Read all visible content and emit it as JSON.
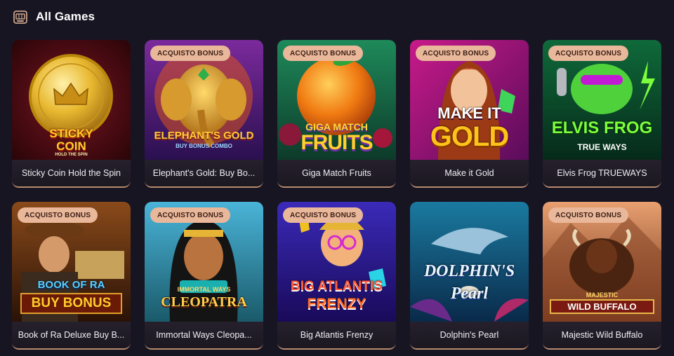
{
  "header": {
    "title": "All Games",
    "icon": "slot-machine-icon"
  },
  "badge_text": "ACQUISTO BONUS",
  "games": [
    {
      "title": "Sticky Coin Hold the Spin",
      "logo_line1": "STICKY",
      "logo_line2": "COIN",
      "logo_line3": "HOLD THE SPIN"
    },
    {
      "title": "Elephant's Gold: Buy Bo...",
      "logo_line1": "ELEPHANT'S GOLD",
      "logo_line2": "BUY BONUS COMBO"
    },
    {
      "title": "Giga Match Fruits",
      "logo_line1": "GIGA MATCH",
      "logo_line2": "FRUITS"
    },
    {
      "title": "Make it Gold",
      "logo_line1": "MAKE IT",
      "logo_line2": "GOLD"
    },
    {
      "title": "Elvis Frog TRUEWAYS",
      "logo_line1": "ELVIS FROG",
      "logo_line2": "TRUE WAYS"
    },
    {
      "title": "Book of Ra Deluxe Buy B...",
      "logo_line1": "BOOK OF RA",
      "logo_line2": "BUY BONUS"
    },
    {
      "title": "Immortal Ways Cleopa...",
      "logo_line1": "IMMORTAL WAYS",
      "logo_line2": "CLEOPATRA"
    },
    {
      "title": "Big Atlantis Frenzy",
      "logo_line1": "BIG ATLANTIS",
      "logo_line2": "FRENZY"
    },
    {
      "title": "Dolphin's Pearl",
      "logo_line1": "DOLPHIN'S",
      "logo_line2": "Pearl"
    },
    {
      "title": "Majestic Wild Buffalo",
      "logo_line1": "MAJESTIC",
      "logo_line2": "WILD BUFFALO"
    }
  ]
}
